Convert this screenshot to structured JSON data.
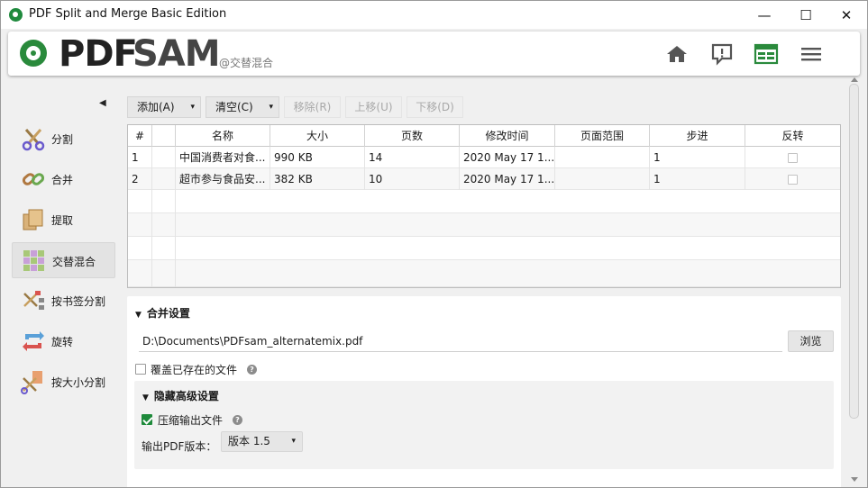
{
  "window": {
    "title": "PDF Split and Merge Basic Edition",
    "minimize_glyph": "—",
    "maximize_glyph": "☐",
    "close_glyph": "✕"
  },
  "header": {
    "logo_pdf": "PDF",
    "logo_sam": "SAM",
    "logo_sub": "@交替混合",
    "icons": [
      "home-icon",
      "feedback-icon",
      "dashboard-icon",
      "menu-icon"
    ],
    "accent_color": "#2a8a3c"
  },
  "sidebar": {
    "collapse_glyph": "◀",
    "items": [
      {
        "label": "分割",
        "icon": "scissors-icon"
      },
      {
        "label": "合并",
        "icon": "merge-chain-icon"
      },
      {
        "label": "提取",
        "icon": "extract-pages-icon"
      },
      {
        "label": "交替混合",
        "icon": "alternate-mix-icon",
        "active": true
      },
      {
        "label": "按书签分割",
        "icon": "bookmark-split-icon"
      },
      {
        "label": "旋转",
        "icon": "rotate-icon"
      },
      {
        "label": "按大小分割",
        "icon": "size-split-icon"
      }
    ]
  },
  "toolbar": {
    "add_label": "添加(A)",
    "clear_label": "清空(C)",
    "remove_label": "移除(R)",
    "move_up_label": "上移(U)",
    "move_down_label": "下移(D)",
    "caret": "▾"
  },
  "table": {
    "headers": [
      "#",
      "",
      "名称",
      "大小",
      "页数",
      "修改时间",
      "页面范围",
      "步进",
      "反转"
    ],
    "rows": [
      {
        "num": "1",
        "name": "中国消费者对食...",
        "size": "990 KB",
        "pages": "14",
        "modified": "2020 May 17 1...",
        "range": "",
        "step": "1"
      },
      {
        "num": "2",
        "name": "超市参与食品安...",
        "size": "382 KB",
        "pages": "10",
        "modified": "2020 May 17 1...",
        "range": "",
        "step": "1"
      }
    ]
  },
  "merge_settings": {
    "title": "合并设置",
    "output_path": "D:\\Documents\\PDFsam_alternatemix.pdf",
    "browse_label": "浏览",
    "overwrite_label": "覆盖已存在的文件",
    "overwrite_checked": false,
    "advanced_title": "隐藏高级设置",
    "compress_label": "压缩输出文件",
    "compress_checked": true,
    "pdf_version_label": "输出PDF版本：",
    "pdf_version_value": "版本 1.5",
    "help_glyph": "?"
  }
}
